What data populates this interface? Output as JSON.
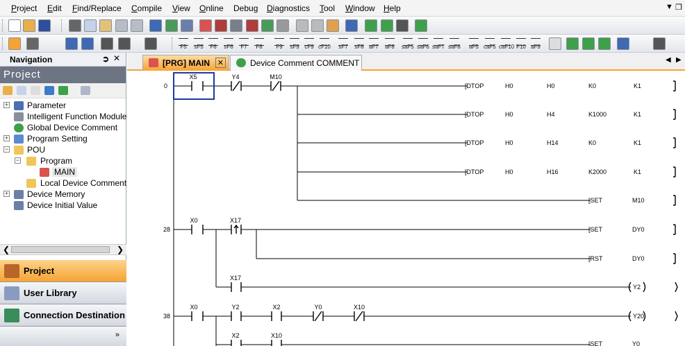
{
  "menu": [
    "Project",
    "Edit",
    "Find/Replace",
    "Compile",
    "View",
    "Online",
    "Debug",
    "Diagnostics",
    "Tool",
    "Window",
    "Help"
  ],
  "menu_ul": [
    "P",
    "E",
    "F",
    "C",
    "V",
    "O",
    "g",
    "D",
    "T",
    "W",
    "H"
  ],
  "fkeys": [
    "F5",
    "sF5",
    "F6",
    "sF6",
    "F7",
    "F8",
    "F9",
    "sF9",
    "cF9",
    "cF10",
    "sF7",
    "sF8",
    "aF7",
    "aF8",
    "saF5",
    "saF6",
    "saF7",
    "saF8",
    "aF5",
    "caF5",
    "caF10",
    "F10",
    "aF9"
  ],
  "nav": {
    "title": "Navigation",
    "project_label": "Project",
    "tree": [
      "Parameter",
      "Intelligent Function Module",
      "Global Device Comment",
      "Program Setting",
      "POU",
      "Program",
      "MAIN",
      "Local Device Comment",
      "Device Memory",
      "Device Initial Value"
    ],
    "buttons": [
      "Project",
      "User Library",
      "Connection Destination"
    ]
  },
  "tabs": [
    "[PRG] MAIN",
    "Device Comment COMMENT"
  ],
  "ladder": {
    "steps": [
      "0",
      "28",
      "38"
    ],
    "contacts": [
      "X5",
      "Y4",
      "M10",
      "X0",
      "X17",
      "X17",
      "X0",
      "Y2",
      "X2",
      "Y0",
      "X10",
      "X2",
      "X10"
    ],
    "instr": [
      [
        "[DTOP",
        "H0",
        "H0",
        "K0",
        "K1"
      ],
      [
        "[DTOP",
        "H0",
        "H4",
        "K1000",
        "K1"
      ],
      [
        "[DTOP",
        "H0",
        "H14",
        "K0",
        "K1"
      ],
      [
        "[DTOP",
        "H0",
        "H16",
        "K2000",
        "K1"
      ],
      [
        "[SET",
        "M10"
      ],
      [
        "[SET",
        "DY0"
      ],
      [
        "[RST",
        "DY0"
      ],
      [
        "[SET",
        "Y0"
      ]
    ],
    "coils": [
      "Y2",
      "Y20"
    ]
  },
  "colors": {
    "accent": "#f7a334",
    "cursor": "#1f3a9a"
  }
}
